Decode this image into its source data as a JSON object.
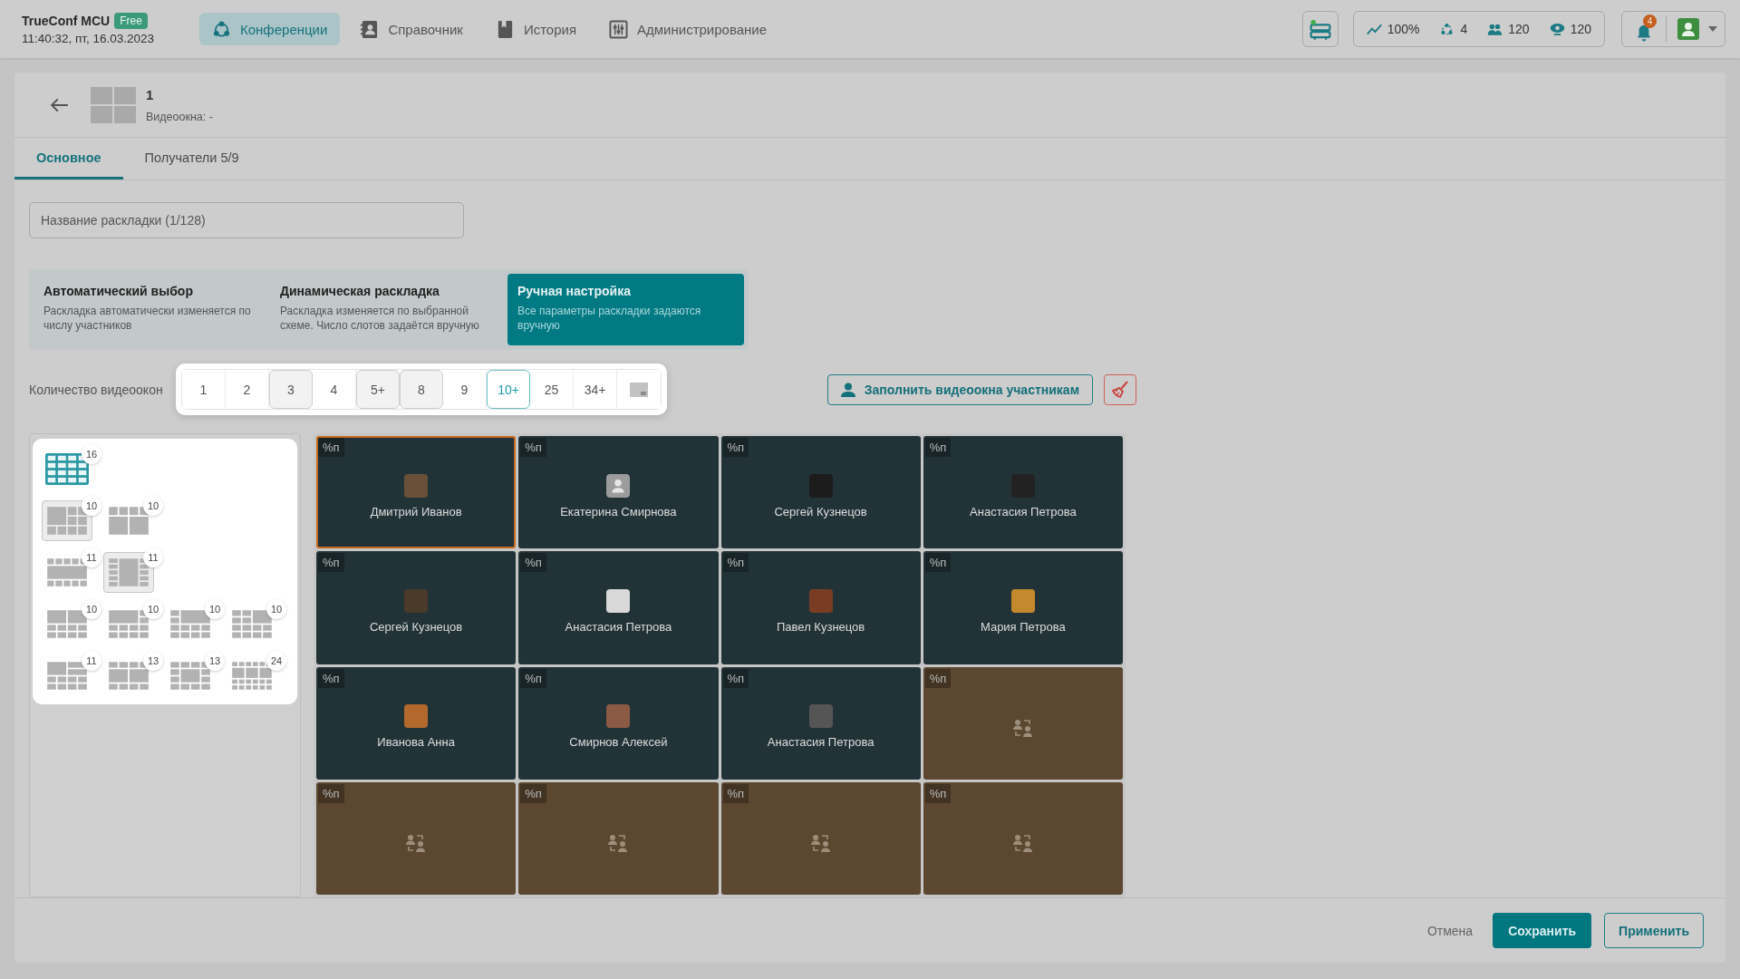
{
  "header": {
    "brand": "TrueConf MCU",
    "badge": "Free",
    "datetime": "11:40:32, пт, 16.03.2023",
    "nav": [
      {
        "label": "Конференции",
        "selected": true
      },
      {
        "label": "Справочник",
        "selected": false
      },
      {
        "label": "История",
        "selected": false
      },
      {
        "label": "Администрирование",
        "selected": false
      }
    ],
    "stats": [
      "100%",
      "4",
      "120",
      "120"
    ],
    "notifications": "4"
  },
  "layout": {
    "title": "1",
    "subtitle": "Видеоокна: -"
  },
  "tabs": [
    {
      "label": "Основное",
      "selected": true
    },
    {
      "label": "Получатели 5/9",
      "selected": false
    }
  ],
  "name_field": {
    "placeholder": "Название раскладки (1/128)"
  },
  "modes": [
    {
      "title": "Автоматический выбор",
      "description": "Раскладка автоматически изменяется по числу участников",
      "selected": false
    },
    {
      "title": "Динамическая раскладка",
      "description": "Раскладка изменяется по выбранной схеме. Число слотов задаётся вручную",
      "selected": false
    },
    {
      "title": "Ручная настройка",
      "description": "Все параметры раскладки задаются вручную",
      "selected": true
    }
  ],
  "window_count": {
    "label": "Количество видеоокон",
    "options": [
      {
        "kind": "number",
        "label": "1",
        "highlighted": false,
        "selected": false
      },
      {
        "kind": "number",
        "label": "2",
        "highlighted": false,
        "selected": false
      },
      {
        "kind": "number",
        "label": "3",
        "highlighted": true,
        "selected": false
      },
      {
        "kind": "number",
        "label": "4",
        "highlighted": false,
        "selected": false
      },
      {
        "kind": "number",
        "label": "5+",
        "highlighted": true,
        "selected": false
      },
      {
        "kind": "number",
        "label": "8",
        "highlighted": true,
        "selected": false
      },
      {
        "kind": "number",
        "label": "9",
        "highlighted": false,
        "selected": false
      },
      {
        "kind": "number",
        "label": "10+",
        "highlighted": false,
        "selected": true
      },
      {
        "kind": "number",
        "label": "25",
        "highlighted": false,
        "selected": false
      },
      {
        "kind": "number",
        "label": "34+",
        "highlighted": false,
        "selected": false
      },
      {
        "kind": "icon",
        "highlighted": false,
        "selected": false
      }
    ]
  },
  "fill_button": "Заполнить видеоокна участникам",
  "schemes": [
    [
      {
        "count": "16",
        "selected": true,
        "highlighted": false
      }
    ],
    [
      {
        "count": "10",
        "selected": false,
        "highlighted": true
      },
      {
        "count": "10",
        "selected": false,
        "highlighted": false
      }
    ],
    [
      {
        "count": "11",
        "selected": false,
        "highlighted": false
      },
      {
        "count": "11",
        "selected": false,
        "highlighted": true
      }
    ],
    [
      {
        "count": "10",
        "selected": false,
        "highlighted": false
      },
      {
        "count": "10",
        "selected": false,
        "highlighted": false
      },
      {
        "count": "10",
        "selected": false,
        "highlighted": false
      },
      {
        "count": "10",
        "selected": false,
        "highlighted": false
      }
    ],
    [
      {
        "count": "11",
        "selected": false,
        "highlighted": false
      },
      {
        "count": "13",
        "selected": false,
        "highlighted": false
      },
      {
        "count": "13",
        "selected": false,
        "highlighted": false
      },
      {
        "count": "24",
        "selected": false,
        "highlighted": false
      }
    ]
  ],
  "slots": [
    {
      "tag": "%п",
      "kind": "photo",
      "name": "Дмитрий Иванов",
      "selected": true
    },
    {
      "tag": "%п",
      "kind": "no-photo",
      "name": "Екатерина Смирнова",
      "selected": false
    },
    {
      "tag": "%п",
      "kind": "photo",
      "name": "Сергей Кузнецов",
      "selected": false
    },
    {
      "tag": "%п",
      "kind": "photo",
      "name": "Анастасия Петрова",
      "selected": false
    },
    {
      "tag": "%п",
      "kind": "photo",
      "name": "Сергей Кузнецов",
      "selected": false
    },
    {
      "tag": "%п",
      "kind": "photo",
      "name": "Анастасия Петрова",
      "selected": false
    },
    {
      "tag": "%п",
      "kind": "photo",
      "name": "Павел Кузнецов",
      "selected": false
    },
    {
      "tag": "%п",
      "kind": "photo",
      "name": "Мария Петрова",
      "selected": false
    },
    {
      "tag": "%п",
      "kind": "photo",
      "name": "Иванова Анна",
      "selected": false
    },
    {
      "tag": "%п",
      "kind": "photo",
      "name": "Смирнов Алексей",
      "selected": false
    },
    {
      "tag": "%п",
      "kind": "photo",
      "name": "Анастасия Петрова",
      "selected": false
    },
    {
      "tag": "%п",
      "kind": "empty",
      "selected": false
    },
    {
      "tag": "%п",
      "kind": "empty",
      "selected": false
    },
    {
      "tag": "%п",
      "kind": "empty",
      "selected": false
    },
    {
      "tag": "%п",
      "kind": "empty",
      "selected": false
    },
    {
      "tag": "%п",
      "kind": "empty",
      "selected": false
    }
  ],
  "footer": {
    "cancel": "Отмена",
    "save": "Сохранить",
    "apply": "Применить"
  }
}
